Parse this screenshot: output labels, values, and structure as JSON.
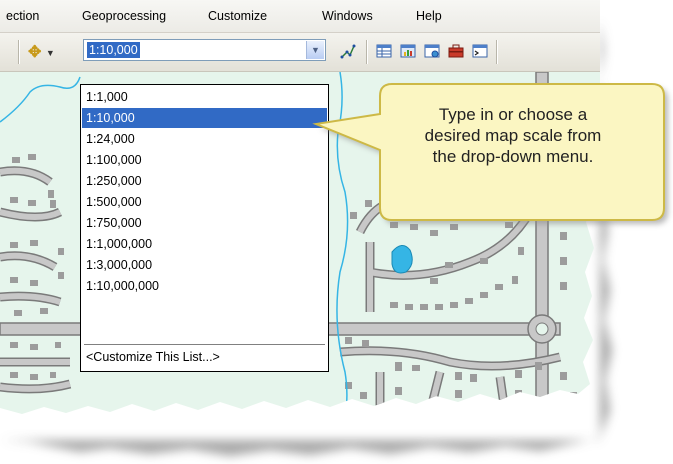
{
  "menubar": {
    "items": [
      {
        "label": "ection"
      },
      {
        "label": "Geoprocessing"
      },
      {
        "label": "Customize"
      },
      {
        "label": "Windows"
      },
      {
        "label": "Help"
      }
    ]
  },
  "toolbar": {
    "scale_value": "1:10,000",
    "icons": [
      "pan-tool-icon",
      "scale-dropdown-arrow-icon",
      "editor-sketch-icon",
      "table-icon",
      "chart-icon",
      "window-icon",
      "toolbox-icon",
      "command-line-icon"
    ]
  },
  "scale_dropdown": {
    "options": [
      "1:1,000",
      "1:10,000",
      "1:24,000",
      "1:100,000",
      "1:250,000",
      "1:500,000",
      "1:750,000",
      "1:1,000,000",
      "1:3,000,000",
      "1:10,000,000"
    ],
    "selected": "1:10,000",
    "customize_label": "<Customize This List...>"
  },
  "callout": {
    "lines": [
      "Type in or choose a",
      "desired map scale from",
      "the drop-down menu."
    ]
  },
  "colors": {
    "map_background": "#e6f5ec",
    "road_fill": "#c8c8c8",
    "road_outline": "#7a7a7a",
    "water": "#35b5e5",
    "selection": "#316ac5",
    "callout_fill": "#fbf6c2",
    "callout_border": "#cdb946"
  }
}
